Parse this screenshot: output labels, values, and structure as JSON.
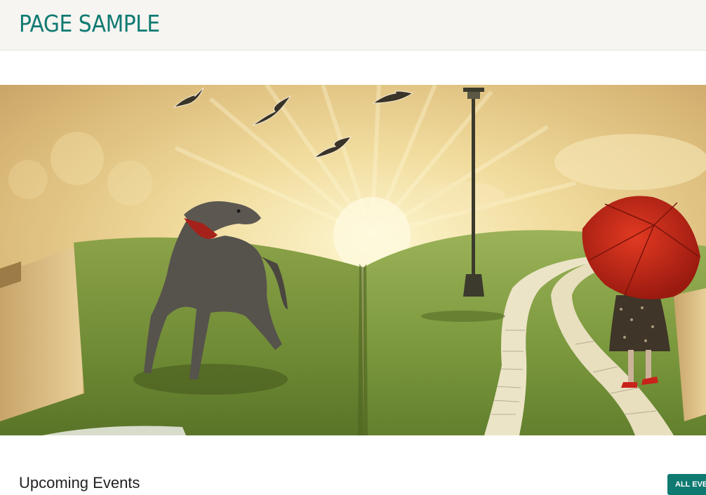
{
  "header": {
    "site_title": "PAGE SAMPLE",
    "title_color": "#0f7a72",
    "background": "#f6f5f1"
  },
  "hero": {
    "description_icons": [
      "open-book-scene",
      "dog",
      "birds",
      "lamp-post",
      "girl-with-red-umbrella",
      "text-path"
    ]
  },
  "events": {
    "heading": "Upcoming Events",
    "all_events_label": "ALL EVENTS",
    "accent_color": "#0f7a72"
  }
}
